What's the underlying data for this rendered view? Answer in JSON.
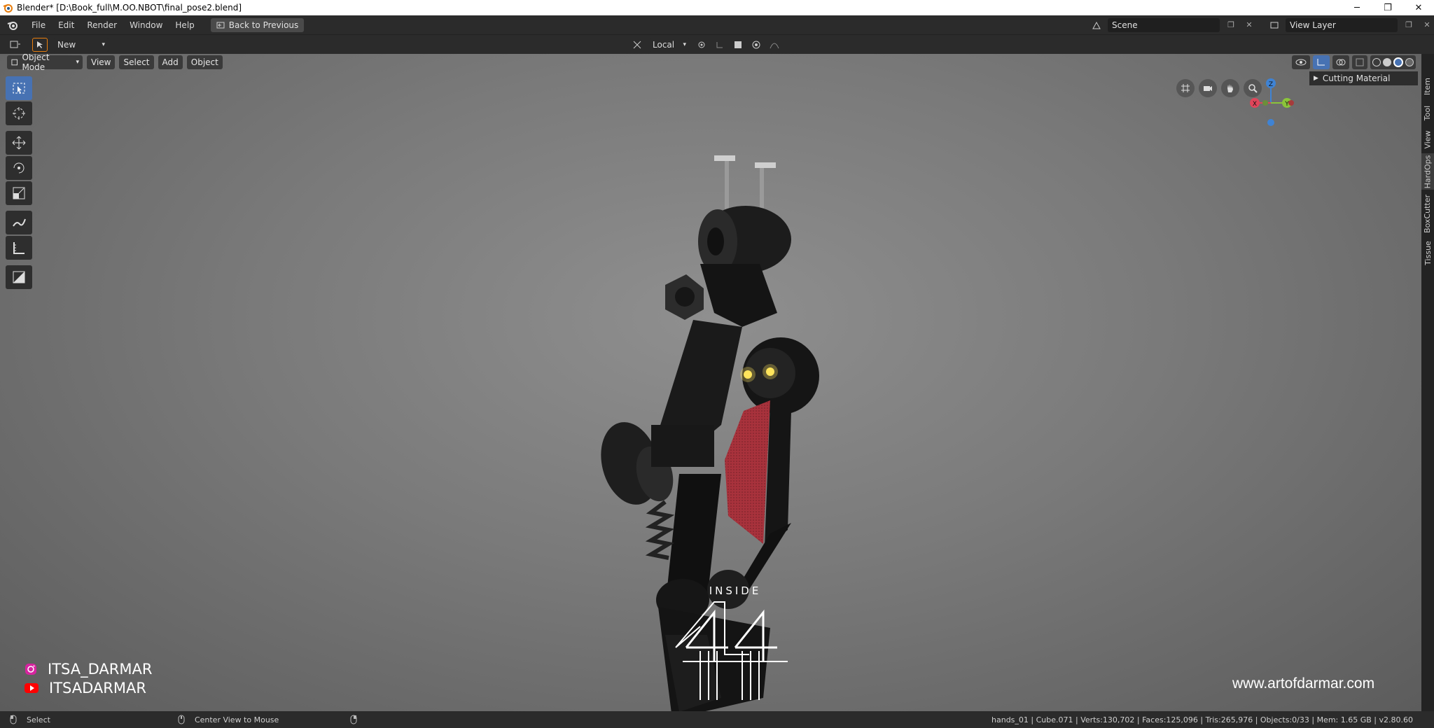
{
  "window": {
    "title": "Blender* [D:\\Book_full\\M.OO.NBOT\\final_pose2.blend]",
    "minimize": "─",
    "maximize": "❐",
    "close": "✕"
  },
  "menubar": {
    "items": [
      "File",
      "Edit",
      "Render",
      "Window",
      "Help"
    ],
    "back_button": "Back to Previous",
    "scene": "Scene",
    "view_layer": "View Layer"
  },
  "header2": {
    "new_label": "New",
    "transform_orientation": "Local"
  },
  "viewport": {
    "mode": "Object Mode",
    "menus": [
      "View",
      "Select",
      "Add",
      "Object"
    ],
    "npanel_title": "Cutting Material",
    "axes": {
      "x": "X",
      "y": "Y",
      "z": "Z"
    }
  },
  "sidebar_tabs": [
    "Item",
    "Tool",
    "View",
    "HardOps",
    "BoxCutter",
    "Tissue"
  ],
  "overlay": {
    "instagram": "ITSA_DARMAR",
    "youtube": "ITSADARMAR",
    "website": "www.artofdarmar.com",
    "watermark_text": "INSIDE"
  },
  "statusbar": {
    "left_action": "Select",
    "middle_action": "Center View to Mouse",
    "stats": "hands_01 | Cube.071 | Verts:130,702 | Faces:125,096 | Tris:265,976 | Objects:0/33 | Mem: 1.65 GB | v2.80.60"
  },
  "colors": {
    "accent": "#4772b3",
    "axis_x": "#e0455a",
    "axis_y": "#8bc43a",
    "axis_z": "#3f83d4",
    "glow": "#ffe55c",
    "red_panel": "#a8323c"
  }
}
